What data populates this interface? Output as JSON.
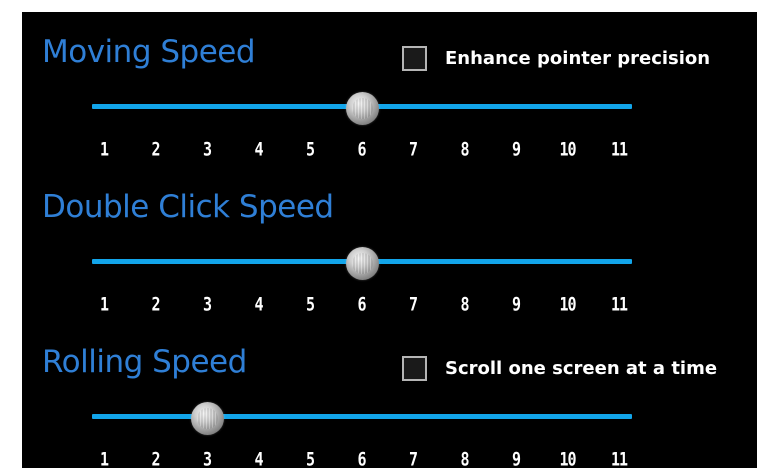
{
  "moving_speed": {
    "title": "Moving Speed",
    "checkbox_label": "Enhance pointer precision",
    "checkbox_checked": false,
    "value": 6
  },
  "double_click_speed": {
    "title": "Double Click Speed",
    "value": 6
  },
  "rolling_speed": {
    "title": "Rolling Speed",
    "checkbox_label": "Scroll one screen at a time",
    "checkbox_checked": false,
    "value": 3
  },
  "scale": {
    "min": 1,
    "max": 11,
    "ticks": [
      "1",
      "2",
      "3",
      "4",
      "5",
      "6",
      "7",
      "8",
      "9",
      "10",
      "11"
    ]
  },
  "colors": {
    "title": "#2f7fd6",
    "track": "#12a5ea",
    "background": "#000000"
  }
}
